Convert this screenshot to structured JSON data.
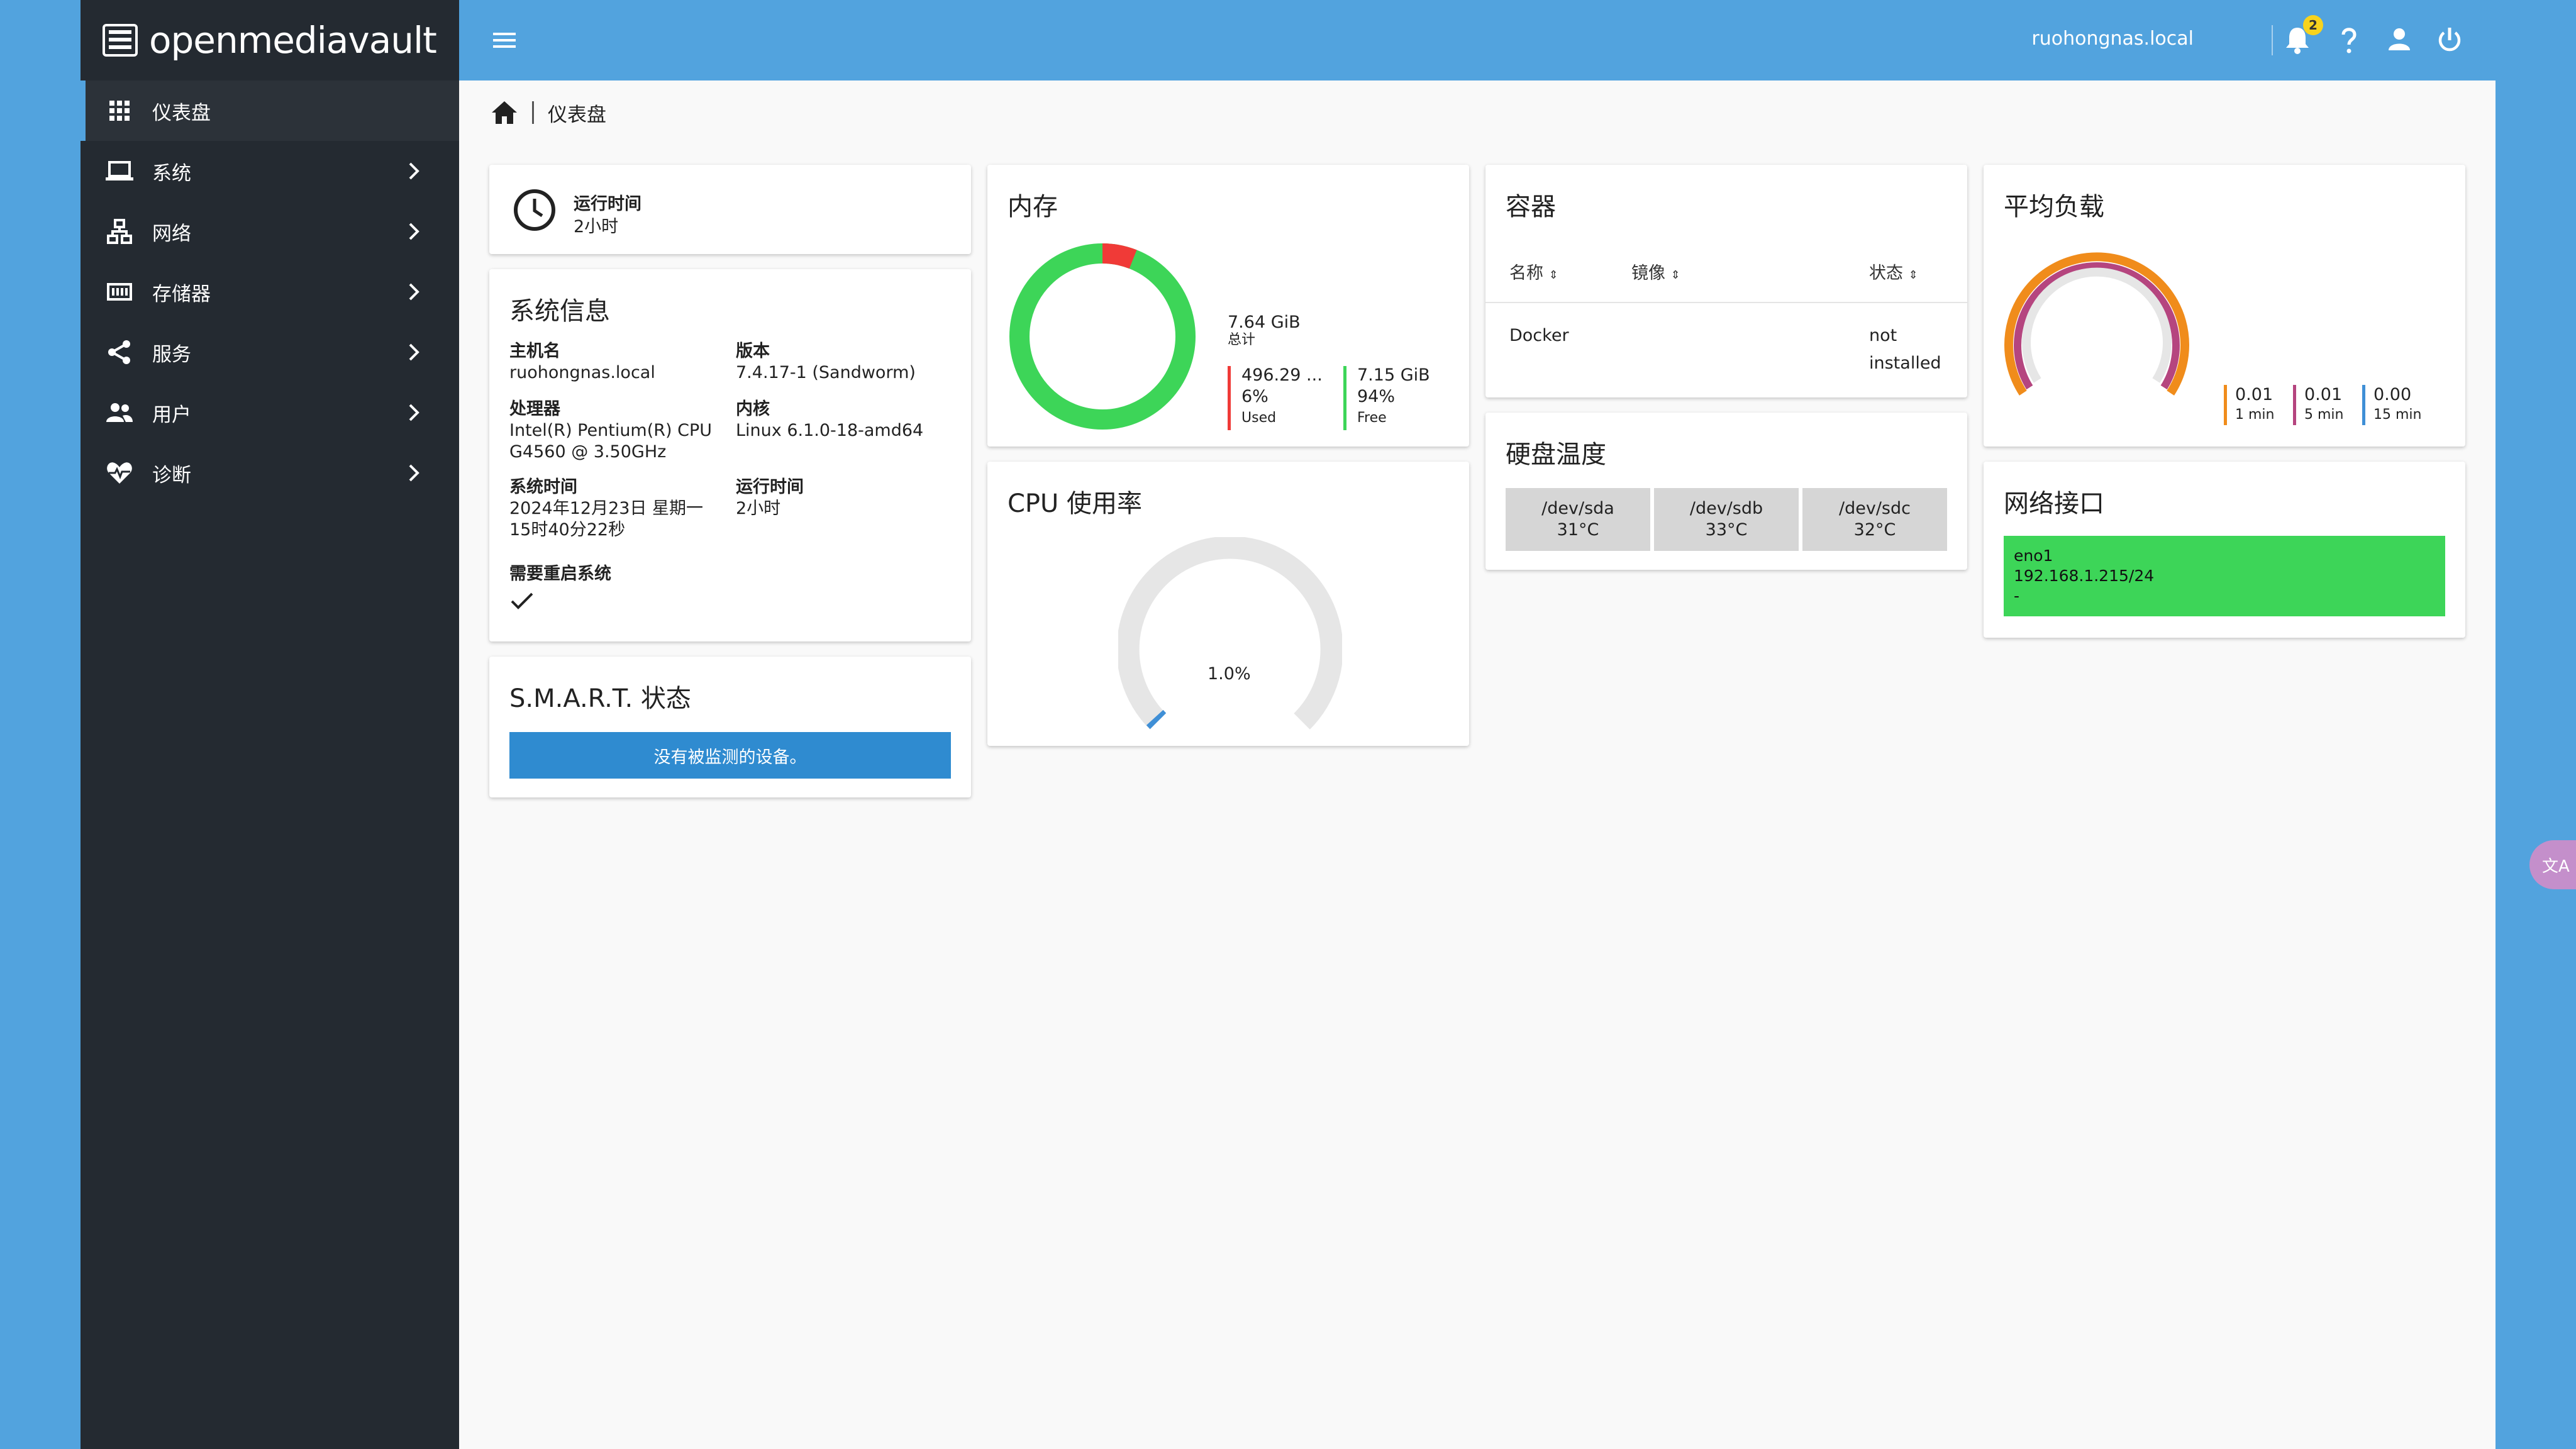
{
  "app": {
    "logo_text": "openmediavault"
  },
  "sidebar": {
    "items": [
      {
        "label": "仪表盘",
        "icon": "dashboard-grid-icon"
      },
      {
        "label": "系统",
        "icon": "laptop-icon"
      },
      {
        "label": "网络",
        "icon": "network-icon"
      },
      {
        "label": "存储器",
        "icon": "storage-icon"
      },
      {
        "label": "服务",
        "icon": "share-icon"
      },
      {
        "label": "用户",
        "icon": "users-icon"
      },
      {
        "label": "诊断",
        "icon": "heart-pulse-icon"
      }
    ]
  },
  "topbar": {
    "hostname": "ruohongnas.local",
    "notification_count": "2"
  },
  "breadcrumb": {
    "current": "仪表盘"
  },
  "uptime_card": {
    "label": "运行时间",
    "value": "2小时"
  },
  "sysinfo": {
    "title": "系统信息",
    "hostname_label": "主机名",
    "hostname": "ruohongnas.local",
    "version_label": "版本",
    "version": "7.4.17-1 (Sandworm)",
    "cpu_label": "处理器",
    "cpu_line1": "Intel(R) Pentium(R) CPU",
    "cpu_line2": "G4560 @ 3.50GHz",
    "kernel_label": "内核",
    "kernel": "Linux 6.1.0-18-amd64",
    "time_label": "系统时间",
    "time_line1": "2024年12月23日 星期一",
    "time_line2": "15时40分22秒",
    "uptime_label": "运行时间",
    "uptime": "2小时",
    "reboot_label": "需要重启系统"
  },
  "smart": {
    "title": "S.M.A.R.T. 状态",
    "message": "没有被监测的设备。"
  },
  "memory": {
    "title": "内存",
    "total": "7.64 GiB",
    "total_label": "总计",
    "used": "496.29 ...",
    "used_pct": "6%",
    "used_label": "Used",
    "free": "7.15 GiB",
    "free_pct": "94%",
    "free_label": "Free",
    "used_fraction": 0.06,
    "colors": {
      "used": "#f03a37",
      "free": "#3dd558"
    }
  },
  "cpu": {
    "title": "CPU 使用率",
    "usage": "1.0%",
    "usage_fraction": 0.01
  },
  "containers": {
    "title": "容器",
    "headers": [
      "名称",
      "镜像",
      "状态"
    ],
    "row": {
      "name": "Docker",
      "image": "",
      "status_line1": "not",
      "status_line2": "installed"
    }
  },
  "disktemp": {
    "title": "硬盘温度",
    "disks": [
      {
        "dev": "/dev/sda",
        "temp": "31°C"
      },
      {
        "dev": "/dev/sdb",
        "temp": "33°C"
      },
      {
        "dev": "/dev/sdc",
        "temp": "32°C"
      }
    ]
  },
  "load": {
    "title": "平均负载",
    "values": [
      {
        "value": "0.01",
        "label": "1 min",
        "color": "#f08c1b"
      },
      {
        "value": "0.01",
        "label": "5 min",
        "color": "#b5457f"
      },
      {
        "value": "0.00",
        "label": "15 min",
        "color": "#3f8fd6"
      }
    ]
  },
  "network": {
    "title": "网络接口",
    "iface": "eno1",
    "address": "192.168.1.215/24",
    "extra": "-",
    "status_color": "#3dd558"
  }
}
